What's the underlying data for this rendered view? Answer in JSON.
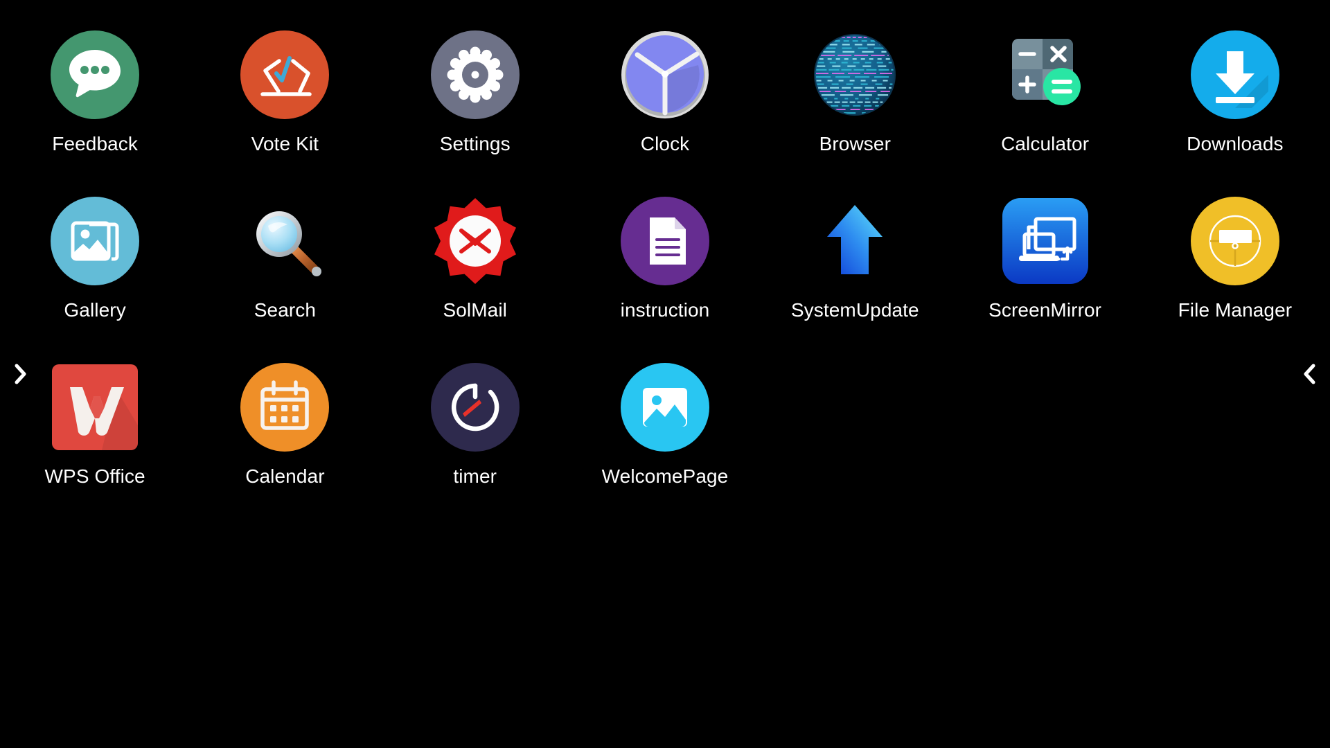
{
  "screen": {
    "type": "android-app-drawer",
    "background_color": "#000000",
    "label_color": "#ffffff",
    "columns": 7,
    "rows": 3
  },
  "navigation": {
    "left_arrow": {
      "icon": "chevron-right-icon",
      "glyph": "›",
      "label": "Next page"
    },
    "right_arrow": {
      "icon": "chevron-left-icon",
      "glyph": "‹",
      "label": "Previous page"
    }
  },
  "apps": [
    {
      "label": "Feedback",
      "icon": "feedback-chat-bubble-icon",
      "shape": "circle",
      "bg": "#44976f",
      "fg": "#ffffff"
    },
    {
      "label": "Vote Kit",
      "icon": "vote-ballot-box-icon",
      "shape": "circle",
      "bg": "#d9512c",
      "fg": "#ffffff",
      "accent": "#3fa9d6"
    },
    {
      "label": "Settings",
      "icon": "gear-icon",
      "shape": "circle",
      "bg": "#6e7287",
      "fg": "#ffffff"
    },
    {
      "label": "Clock",
      "icon": "analog-clock-icon",
      "shape": "circle",
      "bg": "#8287f0",
      "fg": "#ffffff",
      "accent": "#dcdcdc"
    },
    {
      "label": "Browser",
      "icon": "globe-icon",
      "shape": "circle",
      "bg": "#0c2b47",
      "fg": "#36c8e0",
      "accent": "#d86bea"
    },
    {
      "label": "Calculator",
      "icon": "calculator-icon",
      "shape": "rounded-square",
      "bg": "#78909c",
      "fg": "#ffffff",
      "accent": "#29e6a4"
    },
    {
      "label": "Downloads",
      "icon": "download-arrow-icon",
      "shape": "circle",
      "bg": "#14aceb",
      "fg": "#ffffff"
    },
    {
      "label": "Gallery",
      "icon": "photo-stack-icon",
      "shape": "circle",
      "bg": "#63bcd7",
      "fg": "#ffffff"
    },
    {
      "label": "Search",
      "icon": "magnifier-icon",
      "shape": "none",
      "bg": "#bfe6f7",
      "fg": "#ffffff",
      "accent": "#c4713a"
    },
    {
      "label": "SolMail",
      "icon": "mail-badge-icon",
      "shape": "scallop",
      "bg": "#e01b1b",
      "fg": "#ffffff"
    },
    {
      "label": "instruction",
      "icon": "document-icon",
      "shape": "circle",
      "bg": "#662d91",
      "fg": "#ffffff"
    },
    {
      "label": "SystemUpdate",
      "icon": "up-arrow-icon",
      "shape": "none",
      "bg": "#1a5fe0",
      "fg": "#4fd8f5"
    },
    {
      "label": "ScreenMirror",
      "icon": "screen-mirror-icon",
      "shape": "rounded-square",
      "bg": "#1d6fe8",
      "fg": "#ffffff"
    },
    {
      "label": "File Manager",
      "icon": "file-manager-icon",
      "shape": "circle",
      "bg": "#f0bf28",
      "fg": "#ffffff"
    },
    {
      "label": "WPS Office",
      "icon": "wps-w-icon",
      "shape": "rounded-square",
      "bg": "#e0483f",
      "fg": "#f5f0ec"
    },
    {
      "label": "Calendar",
      "icon": "calendar-icon",
      "shape": "circle",
      "bg": "#ef8f28",
      "fg": "#f7f2ee"
    },
    {
      "label": "timer",
      "icon": "stopwatch-icon",
      "shape": "circle",
      "bg": "#2e2a4d",
      "fg": "#ffffff",
      "accent": "#e8312a"
    },
    {
      "label": "WelcomePage",
      "icon": "image-icon",
      "shape": "circle",
      "bg": "#29c6f2",
      "fg": "#ffffff"
    }
  ]
}
